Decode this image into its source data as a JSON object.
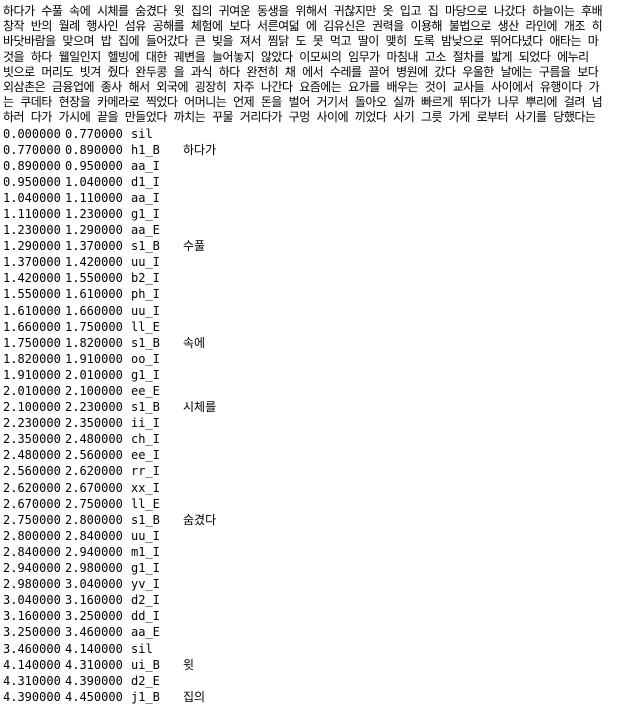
{
  "paragraphs": [
    "하다가 수풀 속에 시체를 숨겼다 윗 집의 귀여운 동생을 위해서 귀찮지만 옷 입고 집 마당으로 나갔다 하늘이는 후배",
    "창작 반의 월례 행사인 섬유 공해를 체험에 보다 서른여덟 에 김유신은 권력을 이용해 불법으로 생산 라인에 개조 히",
    "바닷바람을 맞으며 밥 집에 들어갔다 큰 빚을 져서 찜닭 도 못 먹고 딸이 맺히 도록 밤낮으로 뛰어다녔다 애타는 마",
    "것을 하다 웰일인지 헬빙에 대한 궤변을 늘어놓지 않았다 이모씨의 임무가 마침내 고소 절차를 밟게 되었다 에누리",
    "빗으로 머리도 빗겨 줬다 완두콩 을 과식 하다 완전히 채 에서 수레를 끌어 병원에 갔다 우울한 날에는 구름을 보다",
    "외삼촌은 금융업에 종사 해서 외국에 굉장히 자주 나간다 요즘에는 요가를 배우는 것이 교사들 사이에서 유행이다 가",
    "는 쿠데타 현장을 카메라로 찍었다 어머니는 언제 돈을 벌어 거기서 돌아오 실까 빠르게 뛰다가 나무 뿌리에 걸려 넘",
    "하러 다가 가시에 끝을 만들었다 까치는 꾸물 거리다가 구멍 사이에 끼었다 사기 그릇 가게 로부터 사기를 당했다는"
  ],
  "alignments": [
    {
      "start": "0.000000",
      "end": "0.770000",
      "phone": "sil",
      "word": ""
    },
    {
      "start": "0.770000",
      "end": "0.890000",
      "phone": "h1_B",
      "word": "하다가"
    },
    {
      "start": "0.890000",
      "end": "0.950000",
      "phone": "aa_I",
      "word": ""
    },
    {
      "start": "0.950000",
      "end": "1.040000",
      "phone": "d1_I",
      "word": ""
    },
    {
      "start": "1.040000",
      "end": "1.110000",
      "phone": "aa_I",
      "word": ""
    },
    {
      "start": "1.110000",
      "end": "1.230000",
      "phone": "g1_I",
      "word": ""
    },
    {
      "start": "1.230000",
      "end": "1.290000",
      "phone": "aa_E",
      "word": ""
    },
    {
      "start": "1.290000",
      "end": "1.370000",
      "phone": "s1_B",
      "word": "수풀"
    },
    {
      "start": "1.370000",
      "end": "1.420000",
      "phone": "uu_I",
      "word": ""
    },
    {
      "start": "1.420000",
      "end": "1.550000",
      "phone": "b2_I",
      "word": ""
    },
    {
      "start": "1.550000",
      "end": "1.610000",
      "phone": "ph_I",
      "word": ""
    },
    {
      "start": "1.610000",
      "end": "1.660000",
      "phone": "uu_I",
      "word": ""
    },
    {
      "start": "1.660000",
      "end": "1.750000",
      "phone": "ll_E",
      "word": ""
    },
    {
      "start": "1.750000",
      "end": "1.820000",
      "phone": "s1_B",
      "word": "속에"
    },
    {
      "start": "1.820000",
      "end": "1.910000",
      "phone": "oo_I",
      "word": ""
    },
    {
      "start": "1.910000",
      "end": "2.010000",
      "phone": "g1_I",
      "word": ""
    },
    {
      "start": "2.010000",
      "end": "2.100000",
      "phone": "ee_E",
      "word": ""
    },
    {
      "start": "2.100000",
      "end": "2.230000",
      "phone": "s1_B",
      "word": "시체를"
    },
    {
      "start": "2.230000",
      "end": "2.350000",
      "phone": "ii_I",
      "word": ""
    },
    {
      "start": "2.350000",
      "end": "2.480000",
      "phone": "ch_I",
      "word": ""
    },
    {
      "start": "2.480000",
      "end": "2.560000",
      "phone": "ee_I",
      "word": ""
    },
    {
      "start": "2.560000",
      "end": "2.620000",
      "phone": "rr_I",
      "word": ""
    },
    {
      "start": "2.620000",
      "end": "2.670000",
      "phone": "xx_I",
      "word": ""
    },
    {
      "start": "2.670000",
      "end": "2.750000",
      "phone": "ll_E",
      "word": ""
    },
    {
      "start": "2.750000",
      "end": "2.800000",
      "phone": "s1_B",
      "word": "숨겼다"
    },
    {
      "start": "2.800000",
      "end": "2.840000",
      "phone": "uu_I",
      "word": ""
    },
    {
      "start": "2.840000",
      "end": "2.940000",
      "phone": "m1_I",
      "word": ""
    },
    {
      "start": "2.940000",
      "end": "2.980000",
      "phone": "g1_I",
      "word": ""
    },
    {
      "start": "2.980000",
      "end": "3.040000",
      "phone": "yv_I",
      "word": ""
    },
    {
      "start": "3.040000",
      "end": "3.160000",
      "phone": "d2_I",
      "word": ""
    },
    {
      "start": "3.160000",
      "end": "3.250000",
      "phone": "dd_I",
      "word": ""
    },
    {
      "start": "3.250000",
      "end": "3.460000",
      "phone": "aa_E",
      "word": ""
    },
    {
      "start": "3.460000",
      "end": "4.140000",
      "phone": "sil",
      "word": ""
    },
    {
      "start": "4.140000",
      "end": "4.310000",
      "phone": "ui_B",
      "word": "윗"
    },
    {
      "start": "4.310000",
      "end": "4.390000",
      "phone": "d2_E",
      "word": ""
    },
    {
      "start": "4.390000",
      "end": "4.450000",
      "phone": "j1_B",
      "word": "집의"
    }
  ]
}
